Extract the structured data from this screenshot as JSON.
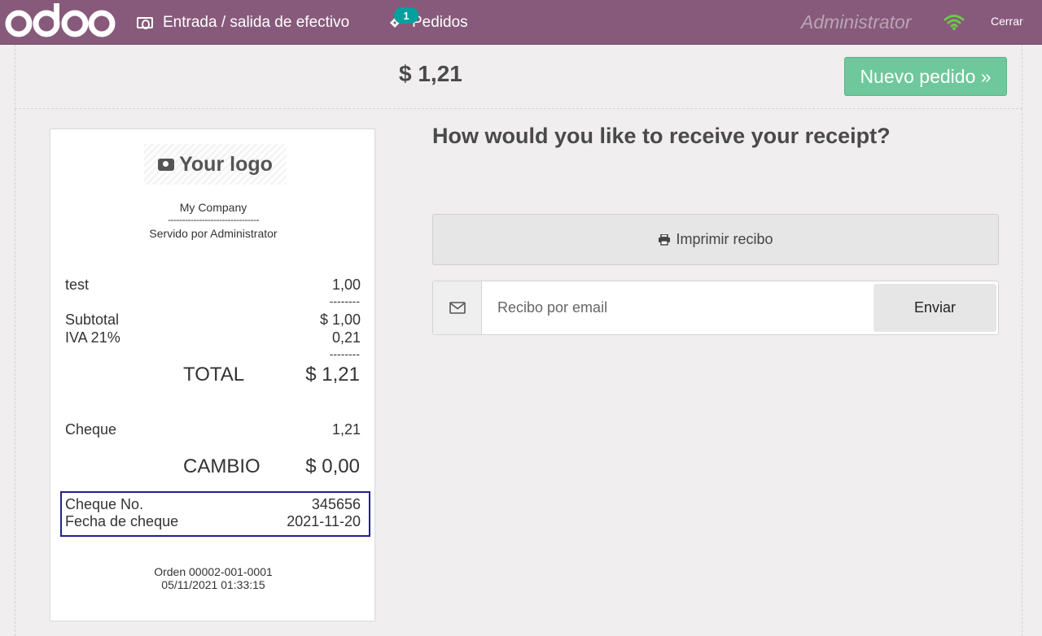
{
  "topbar": {
    "cash_label": "Entrada / salida de efectivo",
    "orders_label": "Pedidos",
    "orders_badge": "1",
    "user_name": "Administrator",
    "close_label": "Cerrar"
  },
  "header": {
    "total": "$ 1,21",
    "new_order_label": "Nuevo pedido »"
  },
  "receipt": {
    "logo_text": "Your logo",
    "company": "My Company",
    "separator": "--------------------------------",
    "served_by": "Servido por Administrator",
    "lines": [
      {
        "name": "test",
        "amount": "1,00"
      }
    ],
    "dashes": "--------",
    "subtotal_label": "Subtotal",
    "subtotal_value": "$ 1,00",
    "tax_label": "IVA 21%",
    "tax_value": "0,21",
    "total_label": "TOTAL",
    "total_value": "$ 1,21",
    "payment_label": "Cheque",
    "payment_value": "1,21",
    "change_label": "CAMBIO",
    "change_value": "$ 0,00",
    "cheque_no_label": "Cheque No.",
    "cheque_no_value": "345656",
    "cheque_date_label": "Fecha de cheque",
    "cheque_date_value": "2021-11-20",
    "order_ref": "Orden 00002-001-0001",
    "order_date": "05/11/2021 01:33:15"
  },
  "right": {
    "question": "How would you like to receive your receipt?",
    "print_label": "Imprimir recibo",
    "email_placeholder": "Recibo por email",
    "send_label": "Enviar"
  },
  "colors": {
    "topbar": "#875a7b",
    "new_order": "#6ec89b",
    "badge": "#00a09d",
    "highlight_box": "#232090"
  }
}
